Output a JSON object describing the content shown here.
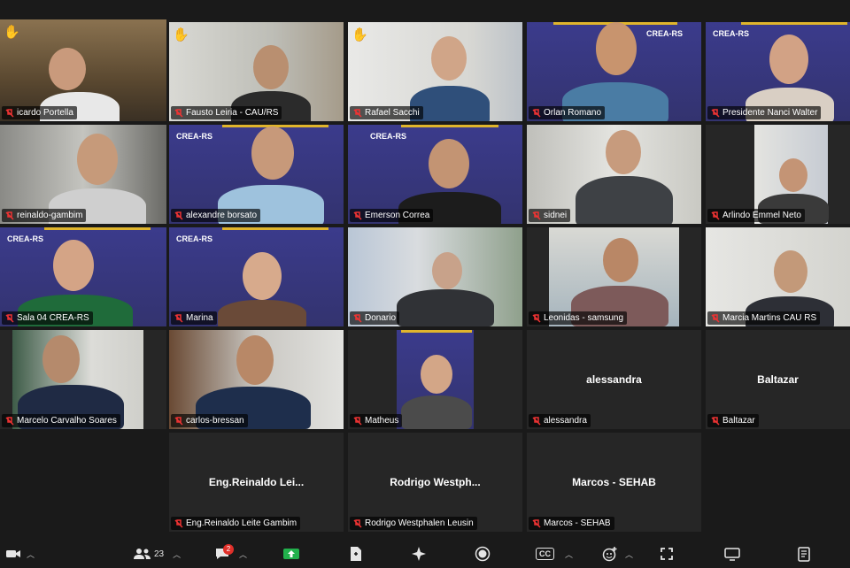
{
  "participants": [
    {
      "name": "icardo Portella",
      "speaking": true,
      "hand": true
    },
    {
      "name": "Fausto Leiria - CAU/RS",
      "hand": true
    },
    {
      "name": "Rafael Sacchi",
      "hand": true
    },
    {
      "name": "Orlan Romano"
    },
    {
      "name": "Presidente Nanci Walter"
    },
    {
      "name": "reinaldo-gambim"
    },
    {
      "name": "alexandre borsato"
    },
    {
      "name": "Emerson Correa"
    },
    {
      "name": "sidnei"
    },
    {
      "name": "Arlindo Emmel Neto"
    },
    {
      "name": "Sala 04 CREA-RS"
    },
    {
      "name": "Marina"
    },
    {
      "name": "Donario"
    },
    {
      "name": "Leonidas - samsung"
    },
    {
      "name": "Marcia Martins CAU RS"
    },
    {
      "name": "Marcelo Carvalho Soares"
    },
    {
      "name": "carlos-bressan"
    },
    {
      "name": "Matheus"
    },
    {
      "name": "alessandra",
      "center": "alessandra"
    },
    {
      "name": "Baltazar",
      "center": "Baltazar"
    },
    {
      "name": "Eng.Reinaldo Leite Gambim",
      "center": "Eng.Reinaldo  Lei..."
    },
    {
      "name": "Rodrigo Westphalen Leusin",
      "center": "Rodrigo  Westph..."
    },
    {
      "name": "Marcos - SEHAB",
      "center": "Marcos - SEHAB"
    }
  ],
  "crea_logo": "CREA-RS",
  "toolbar": {
    "participants_count": "23",
    "chat_badge": "2",
    "cc_label": "CC"
  }
}
